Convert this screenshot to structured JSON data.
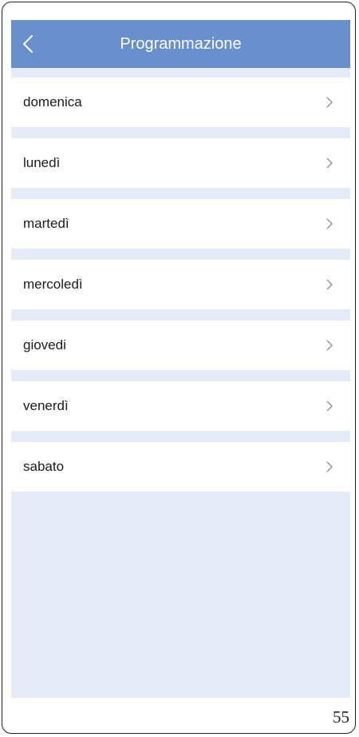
{
  "header": {
    "title": "Programmazione"
  },
  "days": [
    {
      "label": "domenica"
    },
    {
      "label": "lunedì"
    },
    {
      "label": "martedì"
    },
    {
      "label": "mercoledì"
    },
    {
      "label": "giovedi"
    },
    {
      "label": "venerdì"
    },
    {
      "label": "sabato"
    }
  ],
  "page_number": "55",
  "icons": {
    "back": "chevron-left-icon",
    "row": "chevron-right-icon"
  },
  "colors": {
    "header_bg": "#6a8fcd",
    "list_bg": "#e4ebf6",
    "row_bg": "#ffffff"
  }
}
